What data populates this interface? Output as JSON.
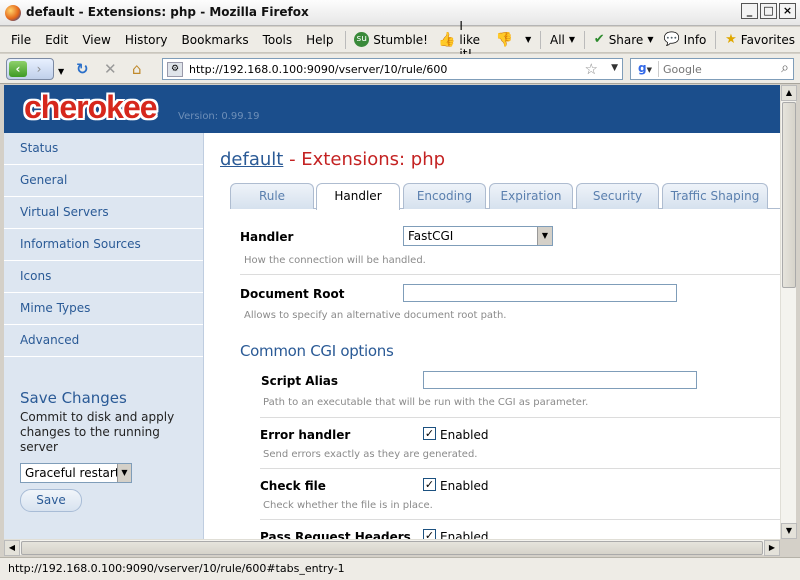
{
  "window": {
    "title": "default - Extensions: php - Mozilla Firefox"
  },
  "menu": {
    "items": [
      "File",
      "Edit",
      "View",
      "History",
      "Bookmarks",
      "Tools",
      "Help"
    ],
    "stumble": "Stumble!",
    "ilike": "I like it!",
    "all": "All",
    "share": "Share",
    "info": "Info",
    "favorites": "Favorites"
  },
  "nav": {
    "url": "http://192.168.0.100:9090/vserver/10/rule/600",
    "search_placeholder": "Google",
    "search_engine": "g"
  },
  "page": {
    "logo": "cherokee",
    "version": "Version: 0.99.19",
    "title_link": "default",
    "title_rest": " - Extensions: php",
    "sidebar": [
      "Status",
      "General",
      "Virtual Servers",
      "Information Sources",
      "Icons",
      "Mime Types",
      "Advanced"
    ],
    "save": {
      "title": "Save Changes",
      "text": "Commit to disk and apply changes to the running server",
      "mode": "Graceful restart",
      "button": "Save"
    },
    "tabs": [
      "Rule",
      "Handler",
      "Encoding",
      "Expiration",
      "Security",
      "Traffic Shaping"
    ],
    "active_tab": "Handler",
    "fields": {
      "handler_label": "Handler",
      "handler_value": "FastCGI",
      "handler_help": "How the connection will be handled.",
      "docroot_label": "Document Root",
      "docroot_value": "",
      "docroot_help": "Allows to specify an alternative document root path.",
      "cgi_section": "Common CGI options",
      "script_alias_label": "Script Alias",
      "script_alias_value": "",
      "script_alias_help": "Path to an executable that will be run with the CGI as parameter.",
      "error_handler_label": "Error handler",
      "error_handler_check": "Enabled",
      "error_handler_help": "Send errors exactly as they are generated.",
      "check_file_label": "Check file",
      "check_file_check": "Enabled",
      "check_file_help": "Check whether the file is in place.",
      "pass_headers_label": "Pass Request Headers",
      "pass_headers_check": "Enabled"
    }
  },
  "status": {
    "text": "http://192.168.0.100:9090/vserver/10/rule/600#tabs_entry-1"
  },
  "colors": {
    "banner": "#1b4e8c",
    "logo": "#d6271c",
    "link": "#2a5a96",
    "title_red": "#c42222"
  }
}
